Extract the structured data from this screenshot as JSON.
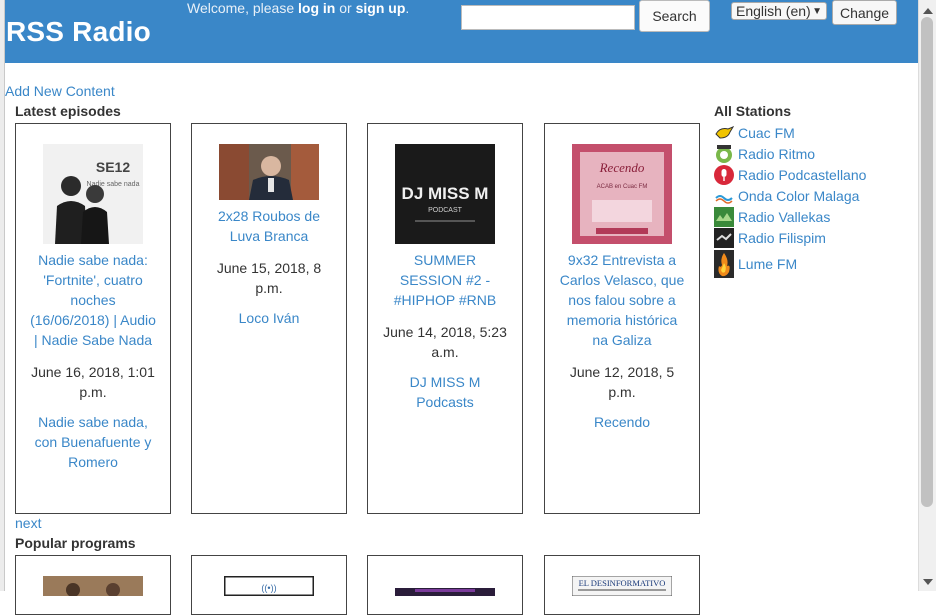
{
  "header": {
    "site_title": "RSS Radio",
    "welcome_prefix": "Welcome, please",
    "login_label": "log in",
    "or_text": "or",
    "signup_label": "sign up",
    "period": ".",
    "search_value": "",
    "search_button": "Search",
    "language_selected": "English (en)",
    "change_button": "Change",
    "accent_color": "#3a87c8"
  },
  "content": {
    "add_new_content": "Add New Content",
    "latest_episodes_title": "Latest episodes",
    "next_label": "next",
    "popular_programs_title": "Popular programs"
  },
  "episodes": [
    {
      "title": "Nadie sabe nada: 'Fortnite', cuatro noches (16/06/2018) | Audio | Nadie Sabe Nada",
      "date": "June 16, 2018, 1:01 p.m.",
      "program": "Nadie sabe nada, con Buenafuente y Romero"
    },
    {
      "title": "2x28 Roubos de Luva Branca",
      "date": "June 15, 2018, 8 p.m.",
      "program": "Loco Iván"
    },
    {
      "title": "SUMMER SESSION #2 - #HIPHOP #RNB",
      "date": "June 14, 2018, 5:23 a.m.",
      "program": "DJ MISS M Podcasts"
    },
    {
      "title": "9x32 Entrevista a Carlos Velasco, que nos falou sobre a memoria histórica na Galiza",
      "date": "June 12, 2018, 5 p.m.",
      "program": "Recendo"
    }
  ],
  "thumb_text": {
    "ep1_badge": "SE12",
    "ep1_sub": "Nadie sabe nada",
    "ep3_line1": "DJ MISS M",
    "ep3_line2": "PODCAST",
    "ep4_title": "Recendo",
    "ep4_sub": "ACAB en Cuac FM",
    "pop4_title": "EL DESINFORMATIVO"
  },
  "sidebar": {
    "title": "All Stations",
    "stations": [
      {
        "name": "Cuac FM",
        "icon": "cuac-fm-logo-icon"
      },
      {
        "name": "Radio Ritmo",
        "icon": "radio-ritmo-logo-icon"
      },
      {
        "name": "Radio Podcastellano",
        "icon": "microphone-icon"
      },
      {
        "name": "Onda Color Malaga",
        "icon": "onda-color-logo-icon"
      },
      {
        "name": "Radio Vallekas",
        "icon": "radio-vallekas-logo-icon"
      },
      {
        "name": "Radio Filispim",
        "icon": "radio-filispim-logo-icon"
      },
      {
        "name": "Lume FM",
        "icon": "flame-icon"
      }
    ]
  }
}
